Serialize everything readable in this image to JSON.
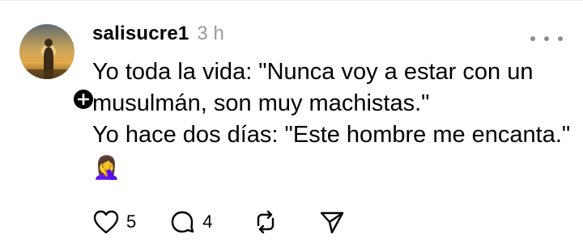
{
  "post": {
    "username": "salisucre1",
    "time": "3 h",
    "lines": [
      "Yo toda la vida: \"Nunca voy a estar con un",
      "musulmán, son muy machistas.\"",
      "Yo hace dos días: \"Este hombre me encanta.\""
    ],
    "emoji": "🤦‍♀️"
  },
  "actions": {
    "likes": "5",
    "comments": "4"
  },
  "icons": {
    "avatar": "profile-photo",
    "follow": "plus-icon",
    "more": "more-horizontal-icon",
    "like": "heart-icon",
    "comment": "comment-icon",
    "repost": "repost-icon",
    "share": "send-icon"
  }
}
